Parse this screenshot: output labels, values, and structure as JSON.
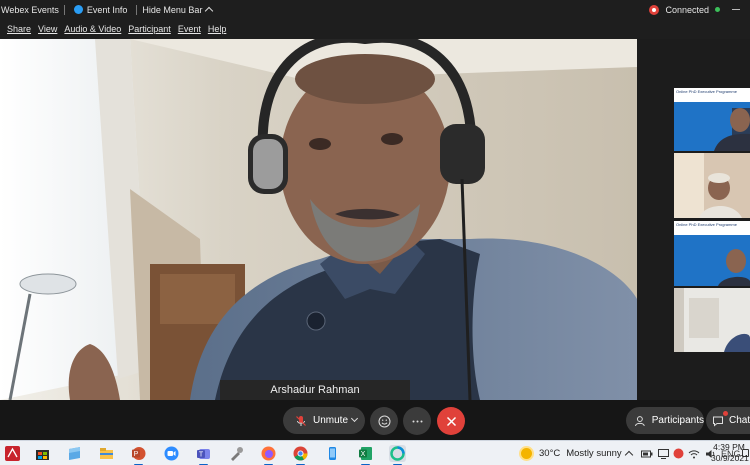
{
  "titlebar": {
    "app_name": "Webex Events",
    "event_info": "Event Info",
    "hide_menu_bar": "Hide Menu Bar",
    "status": "Connected"
  },
  "menubar": {
    "items": [
      "Share",
      "View",
      "Audio & Video",
      "Participant",
      "Event",
      "Help"
    ]
  },
  "main_video": {
    "speaker_name": "Arshadur Rahman"
  },
  "thumbnails": {
    "slide_title": "Online PhD Executive Programme"
  },
  "controls": {
    "unmute_label": "Unmute",
    "reactions_icon": "smiley-icon",
    "more_icon": "ellipsis-icon",
    "end_icon": "close-icon",
    "participants_label": "Participants",
    "chat_label": "Chat"
  },
  "taskbar": {
    "apps": [
      "acrobat",
      "store",
      "files",
      "explorer",
      "powerpoint",
      "zoom",
      "teams",
      "tool",
      "firefox",
      "chrome",
      "phone",
      "excel",
      "webex"
    ],
    "weather_temp": "30°C",
    "weather_text": "Mostly sunny",
    "language": "ENG",
    "time": "4:39 PM",
    "date": "30/9/2021"
  },
  "colors": {
    "accent_red": "#e0413a",
    "connected_green": "#3cc05a",
    "control_bg": "#3b3b3b"
  }
}
